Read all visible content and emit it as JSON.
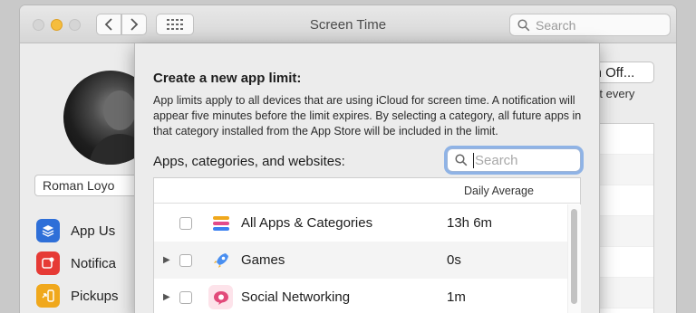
{
  "window": {
    "title": "Screen Time"
  },
  "toolbar": {
    "search_placeholder": "Search"
  },
  "background": {
    "user_name": "Roman Loyo",
    "sidebar": [
      {
        "label": "App Us",
        "icon": "layers-icon"
      },
      {
        "label": "Notifica",
        "icon": "notification-icon"
      },
      {
        "label": "Pickups",
        "icon": "pickup-icon"
      }
    ],
    "turn_off_label": "Turn Off...",
    "reset_text": "s reset every"
  },
  "sheet": {
    "title": "Create a new app limit:",
    "description": "App limits apply to all devices that are using iCloud for screen time. A notification will appear five minutes before the limit expires. By selecting a category, all future apps in that category installed from the App Store will be included in the limit.",
    "list_label": "Apps, categories, and websites:",
    "search_placeholder": "Search",
    "table": {
      "column_daily_average": "Daily Average",
      "rows": [
        {
          "name": "All Apps & Categories",
          "average": "13h 6m",
          "icon": "all-apps-icon",
          "expandable": false
        },
        {
          "name": "Games",
          "average": "0s",
          "icon": "rocket-icon",
          "expandable": true
        },
        {
          "name": "Social Networking",
          "average": "1m",
          "icon": "social-icon",
          "expandable": true
        }
      ]
    }
  },
  "colors": {
    "accent": "#8fb3e6",
    "close": "#f5bd3d"
  }
}
